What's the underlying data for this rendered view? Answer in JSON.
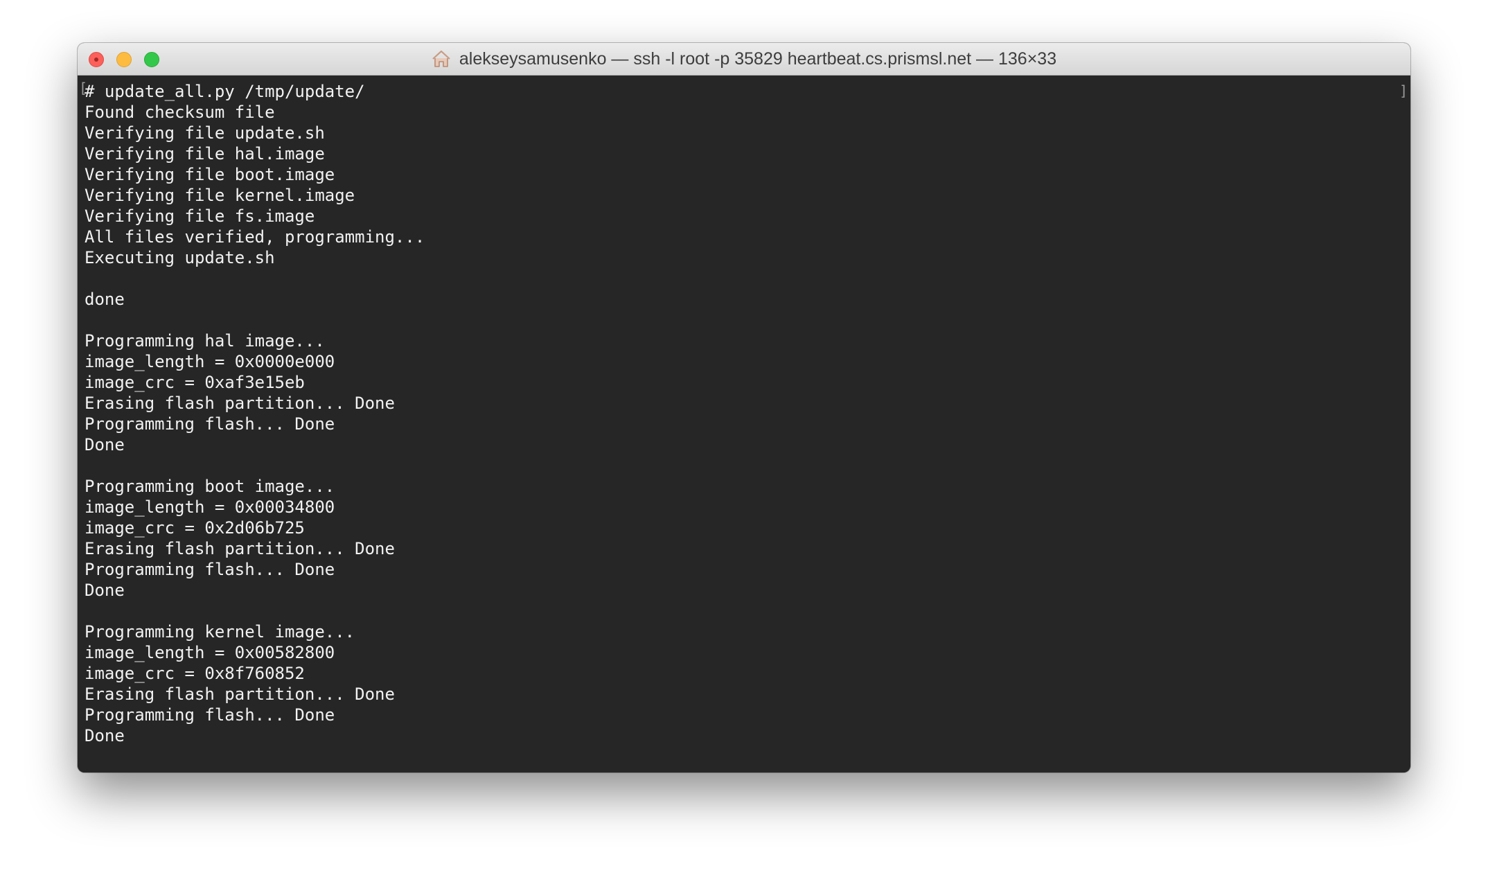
{
  "window": {
    "title": "alekseysamusenko — ssh -l root -p 35829 heartbeat.cs.prismsl.net — 136×33"
  },
  "icons": {
    "close": "close-button",
    "minimize": "minimize-button",
    "zoom": "zoom-button",
    "title": "home-icon"
  },
  "colors": {
    "background": "#262626",
    "text": "#f2f2f2",
    "close": "#fc605b",
    "minimize": "#fdbc40",
    "zoom": "#34c84a"
  },
  "terminal": {
    "left_bracket": "[",
    "right_bracket": "]",
    "lines": [
      "# update_all.py /tmp/update/",
      "Found checksum file",
      "Verifying file update.sh",
      "Verifying file hal.image",
      "Verifying file boot.image",
      "Verifying file kernel.image",
      "Verifying file fs.image",
      "All files verified, programming...",
      "Executing update.sh",
      "",
      "done",
      "",
      "Programming hal image...",
      "image_length = 0x0000e000",
      "image_crc = 0xaf3e15eb",
      "Erasing flash partition... Done",
      "Programming flash... Done",
      "Done",
      "",
      "Programming boot image...",
      "image_length = 0x00034800",
      "image_crc = 0x2d06b725",
      "Erasing flash partition... Done",
      "Programming flash... Done",
      "Done",
      "",
      "Programming kernel image...",
      "image_length = 0x00582800",
      "image_crc = 0x8f760852",
      "Erasing flash partition... Done",
      "Programming flash... Done",
      "Done"
    ]
  }
}
